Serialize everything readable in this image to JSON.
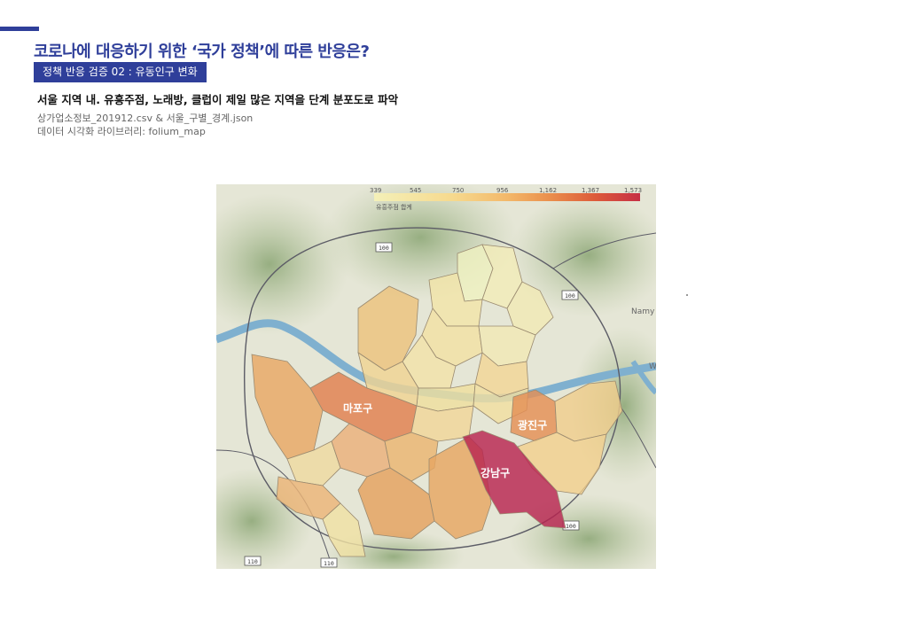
{
  "header": {
    "title": "코로나에 대응하기 위한 ‘국가 정책’에 따른 반응은?",
    "badge": "정책 반응 검증 02 :  유동인구 변화",
    "subtitle": "서울 지역 내. 유흥주점, 노래방, 클럽이 제일 많은 지역을 단계 분포도로 파악",
    "source_files": "상가업소정보_201912.csv & 서울_구별_경계.json",
    "library": "데이터 시각화 라이브러리: folium_map"
  },
  "colors": {
    "accent": "#2f3f9a",
    "scale": [
      "#f4f0b8",
      "#f6d98d",
      "#f3b86a",
      "#ea8f4c",
      "#dd5b3a",
      "#c62f45"
    ]
  },
  "legend": {
    "caption": "유흥주점 합계",
    "ticks": [
      "339",
      "545",
      "750",
      "956",
      "1,162",
      "1,367",
      "1,573"
    ]
  },
  "map": {
    "roads": [
      "100",
      "100",
      "110",
      "110",
      "100"
    ],
    "place_labels": [
      "Namy",
      "W"
    ],
    "districts": [
      {
        "label": "마포구",
        "level": 4
      },
      {
        "label": "광진구",
        "level": 3
      },
      {
        "label": "강남구",
        "level": 5
      }
    ]
  }
}
